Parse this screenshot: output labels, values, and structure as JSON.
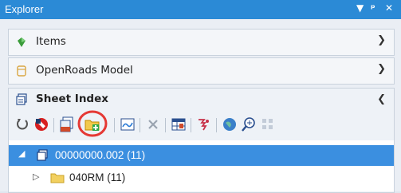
{
  "window": {
    "title": "Explorer",
    "pin_glyph": "▾ ф ✕"
  },
  "panels": [
    {
      "label": "Items",
      "icon": "items-icon",
      "state": "collapsed"
    },
    {
      "label": "OpenRoads Model",
      "icon": "model-icon",
      "state": "collapsed"
    },
    {
      "label": "Sheet Index",
      "icon": "sheet-index-icon",
      "state": "expanded"
    }
  ],
  "toolbar": {
    "buttons": [
      "refresh-icon",
      "no-entry-icon",
      "copy-sheets-icon",
      "add-folder-icon",
      "sheet-wave-icon",
      "delete-icon",
      "table-icon",
      "filter-icon",
      "globe-icon",
      "zoom-icon",
      "grid-icon"
    ]
  },
  "tree": {
    "items": [
      {
        "label": "00000000.002 (11)",
        "icon": "sheet-index-icon",
        "expander": "◢",
        "selected": true
      },
      {
        "label": "040RM (11)",
        "icon": "folder-icon",
        "expander": "▷",
        "selected": false
      }
    ]
  },
  "colors": {
    "selection": "#3b8fe0",
    "titlebar": "#2b8ad6",
    "highlight_circle": "#e53935"
  }
}
